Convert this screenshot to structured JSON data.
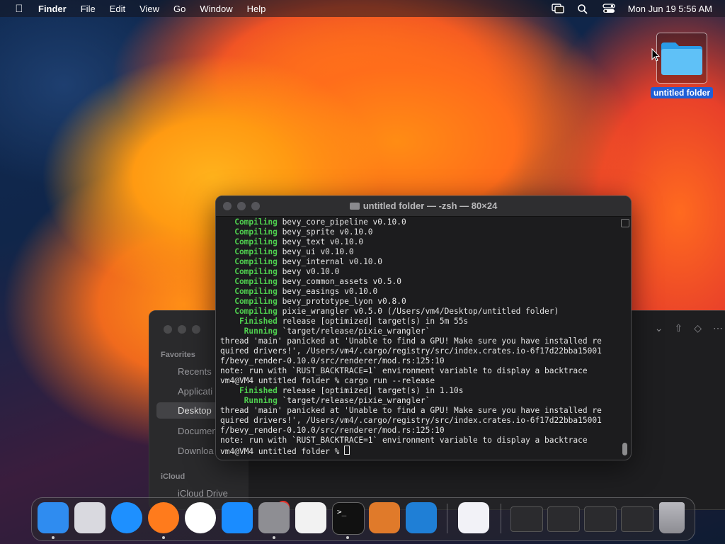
{
  "menubar": {
    "app_name": "Finder",
    "menus": [
      "File",
      "Edit",
      "View",
      "Go",
      "Window",
      "Help"
    ],
    "clock": "Mon Jun 19  5:56 AM"
  },
  "desktop": {
    "folder_label": "untitled folder"
  },
  "terminal": {
    "title": "untitled folder — -zsh — 80×24",
    "lines": [
      {
        "kw": "   Compiling",
        "text": " bevy_core_pipeline v0.10.0"
      },
      {
        "kw": "   Compiling",
        "text": " bevy_sprite v0.10.0"
      },
      {
        "kw": "   Compiling",
        "text": " bevy_text v0.10.0"
      },
      {
        "kw": "   Compiling",
        "text": " bevy_ui v0.10.0"
      },
      {
        "kw": "   Compiling",
        "text": " bevy_internal v0.10.0"
      },
      {
        "kw": "   Compiling",
        "text": " bevy v0.10.0"
      },
      {
        "kw": "   Compiling",
        "text": " bevy_common_assets v0.5.0"
      },
      {
        "kw": "   Compiling",
        "text": " bevy_easings v0.10.0"
      },
      {
        "kw": "   Compiling",
        "text": " bevy_prototype_lyon v0.8.0"
      },
      {
        "kw": "   Compiling",
        "text": " pixie_wrangler v0.5.0 (/Users/vm4/Desktop/untitled folder)"
      },
      {
        "kw": "    Finished",
        "text": " release [optimized] target(s) in 5m 55s"
      },
      {
        "kw": "     Running",
        "text": " `target/release/pixie_wrangler`"
      },
      {
        "kw": "",
        "text": "thread 'main' panicked at 'Unable to find a GPU! Make sure you have installed re"
      },
      {
        "kw": "",
        "text": "quired drivers!', /Users/vm4/.cargo/registry/src/index.crates.io-6f17d22bba15001"
      },
      {
        "kw": "",
        "text": "f/bevy_render-0.10.0/src/renderer/mod.rs:125:10"
      },
      {
        "kw": "",
        "text": "note: run with `RUST_BACKTRACE=1` environment variable to display a backtrace"
      },
      {
        "kw": "",
        "text": "vm4@VM4 untitled folder % cargo run --release"
      },
      {
        "kw": "    Finished",
        "text": " release [optimized] target(s) in 1.10s"
      },
      {
        "kw": "     Running",
        "text": " `target/release/pixie_wrangler`"
      },
      {
        "kw": "",
        "text": "thread 'main' panicked at 'Unable to find a GPU! Make sure you have installed re"
      },
      {
        "kw": "",
        "text": "quired drivers!', /Users/vm4/.cargo/registry/src/index.crates.io-6f17d22bba15001"
      },
      {
        "kw": "",
        "text": "f/bevy_render-0.10.0/src/renderer/mod.rs:125:10"
      },
      {
        "kw": "",
        "text": "note: run with `RUST_BACKTRACE=1` environment variable to display a backtrace"
      },
      {
        "kw": "",
        "text": "vm4@VM4 untitled folder % "
      }
    ]
  },
  "finder": {
    "favorites_header": "Favorites",
    "items": [
      "Recents",
      "Applicati",
      "Desktop",
      "Documen",
      "Downloa"
    ],
    "icloud_header": "iCloud",
    "icloud_item": "iCloud Drive"
  },
  "dock": {
    "apps": [
      {
        "name": "finder-icon",
        "color": "#2f8cf0"
      },
      {
        "name": "launchpad-icon",
        "color": "#d9d9df"
      },
      {
        "name": "safari-icon",
        "color": "#1e90ff"
      },
      {
        "name": "firefox-icon",
        "color": "#ff7b1c"
      },
      {
        "name": "chrome-icon",
        "color": "#ffffff"
      },
      {
        "name": "app-store-icon",
        "color": "#1a8cff"
      },
      {
        "name": "system-settings-icon",
        "color": "#8e8e93"
      },
      {
        "name": "textedit-icon",
        "color": "#f2f2f2"
      },
      {
        "name": "terminal-icon",
        "color": "#111111"
      },
      {
        "name": "garageband-icon",
        "color": "#e07a2a"
      },
      {
        "name": "vscode-icon",
        "color": "#1f7fd6"
      },
      {
        "name": "visual-studio-icon",
        "color": "#f2f2f7"
      }
    ],
    "settings_badge": "2",
    "recent_windows": [
      "finder-window-thumb",
      "settings-window-thumb",
      "finder-desktop-thumb",
      "firefox-window-thumb"
    ],
    "trash": "trash-icon"
  }
}
